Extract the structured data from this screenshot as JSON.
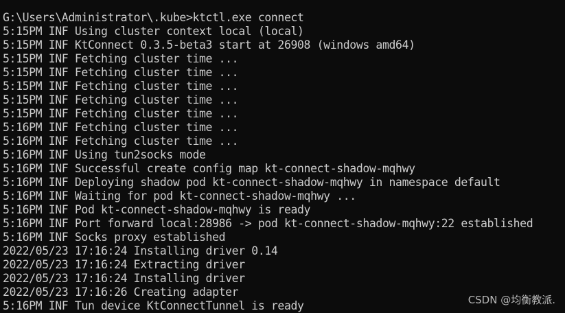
{
  "terminal": {
    "lines": [
      "G:\\Users\\Administrator\\.kube>ktctl.exe connect",
      "5:15PM INF Using cluster context local (local)",
      "5:15PM INF KtConnect 0.3.5-beta3 start at 26908 (windows amd64)",
      "5:15PM INF Fetching cluster time ...",
      "5:15PM INF Fetching cluster time ...",
      "5:15PM INF Fetching cluster time ...",
      "5:15PM INF Fetching cluster time ...",
      "5:15PM INF Fetching cluster time ...",
      "5:16PM INF Fetching cluster time ...",
      "5:16PM INF Fetching cluster time ...",
      "5:16PM INF Using tun2socks mode",
      "5:16PM INF Successful create config map kt-connect-shadow-mqhwy",
      "5:16PM INF Deploying shadow pod kt-connect-shadow-mqhwy in namespace default",
      "5:16PM INF Waiting for pod kt-connect-shadow-mqhwy ...",
      "5:16PM INF Pod kt-connect-shadow-mqhwy is ready",
      "5:16PM INF Port forward local:28986 -> pod kt-connect-shadow-mqhwy:22 established",
      "5:16PM INF Socks proxy established",
      "2022/05/23 17:16:24 Installing driver 0.14",
      "2022/05/23 17:16:24 Extracting driver",
      "2022/05/23 17:16:24 Installing driver",
      "2022/05/23 17:16:26 Creating adapter",
      "5:16PM INF Tun device KtConnectTunnel is ready"
    ]
  },
  "watermark": "CSDN @均衡教派."
}
